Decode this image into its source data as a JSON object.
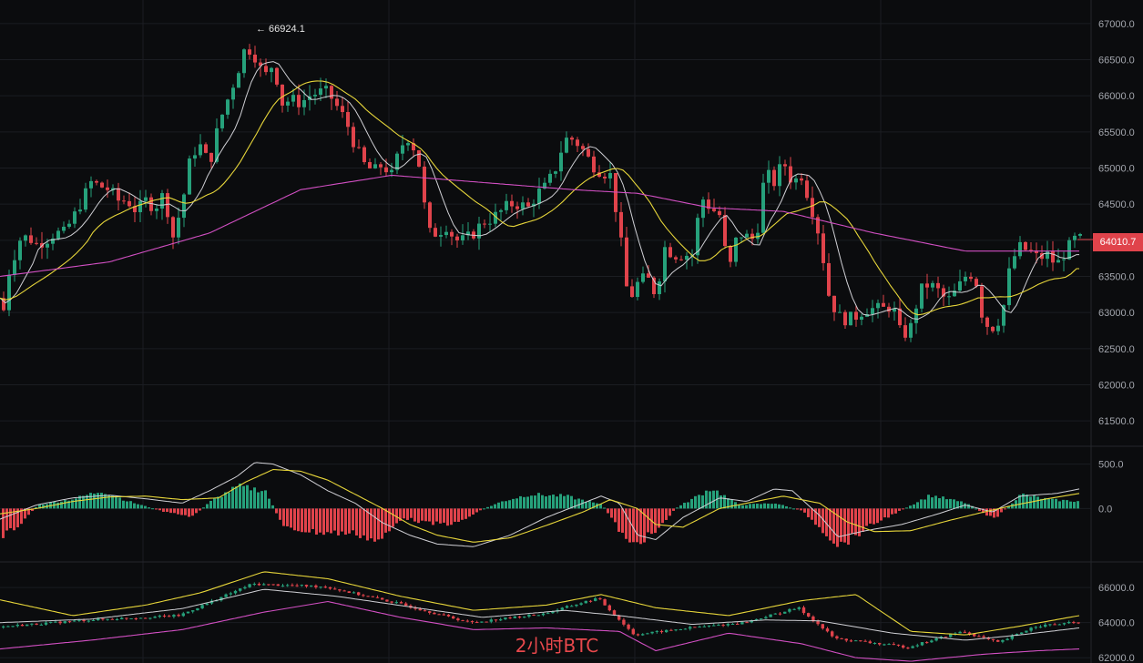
{
  "caption": "2小时BTC",
  "last_price": "64010.7",
  "peak_label": "← 66924.1",
  "colors": {
    "up": "#26a17b",
    "down": "#e0434b",
    "ma_fast": "#cfcfd4",
    "ma_mid": "#e6d53a",
    "ma_slow": "#d14fc2",
    "grid": "#1b1d22",
    "axis_text": "#a3a6ad"
  },
  "chart_data": [
    {
      "type": "candlestick",
      "title": "",
      "panel": "price",
      "ylim": [
        61300,
        67200
      ],
      "y_ticks": [
        "67000.0",
        "66500.0",
        "66000.0",
        "65500.0",
        "65000.0",
        "64500.0",
        "64000.0",
        "63500.0",
        "63000.0",
        "62500.0",
        "62000.0",
        "61500.0"
      ],
      "approx_path": [
        [
          0,
          63200
        ],
        [
          6,
          62800
        ],
        [
          12,
          63500
        ],
        [
          18,
          63700
        ],
        [
          24,
          64000
        ],
        [
          34,
          64050
        ],
        [
          44,
          63950
        ],
        [
          54,
          64000
        ],
        [
          64,
          64100
        ],
        [
          74,
          64100
        ],
        [
          84,
          64300
        ],
        [
          94,
          64550
        ],
        [
          104,
          64800
        ],
        [
          114,
          64750
        ],
        [
          124,
          64700
        ],
        [
          134,
          64550
        ],
        [
          144,
          64550
        ],
        [
          154,
          64400
        ],
        [
          164,
          64550
        ],
        [
          174,
          64450
        ],
        [
          184,
          64650
        ],
        [
          194,
          64050
        ],
        [
          204,
          64500
        ],
        [
          214,
          65200
        ],
        [
          224,
          65300
        ],
        [
          234,
          65050
        ],
        [
          244,
          65600
        ],
        [
          254,
          65950
        ],
        [
          264,
          66300
        ],
        [
          274,
          66700
        ],
        [
          284,
          66550
        ],
        [
          294,
          66250
        ],
        [
          304,
          66450
        ],
        [
          314,
          65900
        ],
        [
          324,
          65950
        ],
        [
          334,
          65900
        ],
        [
          344,
          66000
        ],
        [
          354,
          66050
        ],
        [
          364,
          66050
        ],
        [
          374,
          65850
        ],
        [
          384,
          65650
        ],
        [
          394,
          65300
        ],
        [
          404,
          65050
        ],
        [
          414,
          64950
        ],
        [
          424,
          65050
        ],
        [
          434,
          64900
        ],
        [
          444,
          65300
        ],
        [
          454,
          65450
        ],
        [
          464,
          65050
        ],
        [
          474,
          64100
        ],
        [
          484,
          64100
        ],
        [
          494,
          64200
        ],
        [
          504,
          64000
        ],
        [
          514,
          64000
        ],
        [
          524,
          64100
        ],
        [
          534,
          64250
        ],
        [
          544,
          64300
        ],
        [
          554,
          64400
        ],
        [
          564,
          64500
        ],
        [
          574,
          64500
        ],
        [
          584,
          64450
        ],
        [
          594,
          64650
        ],
        [
          604,
          64750
        ],
        [
          614,
          65000
        ],
        [
          624,
          65400
        ],
        [
          634,
          65400
        ],
        [
          644,
          65250
        ],
        [
          654,
          65050
        ],
        [
          664,
          64950
        ],
        [
          674,
          64900
        ],
        [
          684,
          64150
        ],
        [
          694,
          63150
        ],
        [
          704,
          63400
        ],
        [
          714,
          63500
        ],
        [
          724,
          63250
        ],
        [
          734,
          63900
        ],
        [
          744,
          63800
        ],
        [
          754,
          63800
        ],
        [
          764,
          63800
        ],
        [
          774,
          64600
        ],
        [
          784,
          64450
        ],
        [
          794,
          64350
        ],
        [
          804,
          63550
        ],
        [
          814,
          64100
        ],
        [
          824,
          64050
        ],
        [
          834,
          64000
        ],
        [
          844,
          64950
        ],
        [
          854,
          64800
        ],
        [
          864,
          65100
        ],
        [
          874,
          64800
        ],
        [
          884,
          64900
        ],
        [
          894,
          64500
        ],
        [
          904,
          64050
        ],
        [
          914,
          63250
        ],
        [
          924,
          62950
        ],
        [
          934,
          62900
        ],
        [
          944,
          62950
        ],
        [
          954,
          63050
        ],
        [
          964,
          63050
        ],
        [
          974,
          63050
        ],
        [
          984,
          63100
        ],
        [
          994,
          62650
        ],
        [
          1004,
          62800
        ],
        [
          1014,
          63300
        ],
        [
          1024,
          63400
        ],
        [
          1034,
          63300
        ],
        [
          1044,
          63150
        ],
        [
          1054,
          63300
        ],
        [
          1064,
          63500
        ],
        [
          1074,
          63550
        ],
        [
          1084,
          62850
        ],
        [
          1094,
          62800
        ],
        [
          1104,
          62950
        ],
        [
          1114,
          63700
        ],
        [
          1124,
          63900
        ],
        [
          1134,
          63850
        ],
        [
          1144,
          63750
        ],
        [
          1154,
          63800
        ],
        [
          1164,
          63650
        ],
        [
          1174,
          63850
        ],
        [
          1184,
          64010.7
        ]
      ],
      "ma_slow": [
        [
          0,
          63500
        ],
        [
          120,
          63700
        ],
        [
          230,
          64100
        ],
        [
          330,
          64700
        ],
        [
          430,
          64900
        ],
        [
          530,
          64800
        ],
        [
          630,
          64700
        ],
        [
          700,
          64650
        ],
        [
          780,
          64450
        ],
        [
          860,
          64400
        ],
        [
          960,
          64100
        ],
        [
          1060,
          63850
        ],
        [
          1180,
          63850
        ]
      ],
      "last_price": 64010.7,
      "peak": 66924.1
    },
    {
      "type": "macd",
      "panel": "macd",
      "ylim": [
        -550,
        650
      ],
      "y_ticks": [
        "500.0",
        "0.0"
      ],
      "macd_line": [
        [
          0,
          -120
        ],
        [
          40,
          40
        ],
        [
          80,
          120
        ],
        [
          120,
          150
        ],
        [
          160,
          110
        ],
        [
          200,
          60
        ],
        [
          230,
          200
        ],
        [
          260,
          360
        ],
        [
          280,
          520
        ],
        [
          300,
          500
        ],
        [
          330,
          380
        ],
        [
          360,
          200
        ],
        [
          390,
          60
        ],
        [
          420,
          -160
        ],
        [
          450,
          -300
        ],
        [
          480,
          -400
        ],
        [
          520,
          -430
        ],
        [
          560,
          -300
        ],
        [
          600,
          -100
        ],
        [
          640,
          60
        ],
        [
          660,
          140
        ],
        [
          680,
          60
        ],
        [
          700,
          -300
        ],
        [
          720,
          -350
        ],
        [
          750,
          -100
        ],
        [
          790,
          120
        ],
        [
          820,
          80
        ],
        [
          850,
          220
        ],
        [
          870,
          200
        ],
        [
          900,
          -80
        ],
        [
          920,
          -320
        ],
        [
          950,
          -250
        ],
        [
          990,
          -180
        ],
        [
          1030,
          -60
        ],
        [
          1060,
          40
        ],
        [
          1090,
          -40
        ],
        [
          1120,
          140
        ],
        [
          1160,
          170
        ],
        [
          1185,
          220
        ]
      ],
      "signal_line": [
        [
          0,
          -60
        ],
        [
          40,
          0
        ],
        [
          80,
          80
        ],
        [
          120,
          130
        ],
        [
          160,
          140
        ],
        [
          200,
          100
        ],
        [
          240,
          120
        ],
        [
          270,
          300
        ],
        [
          300,
          440
        ],
        [
          330,
          420
        ],
        [
          360,
          320
        ],
        [
          390,
          160
        ],
        [
          420,
          0
        ],
        [
          450,
          -180
        ],
        [
          480,
          -300
        ],
        [
          520,
          -380
        ],
        [
          560,
          -330
        ],
        [
          600,
          -190
        ],
        [
          640,
          -40
        ],
        [
          670,
          100
        ],
        [
          700,
          0
        ],
        [
          720,
          -180
        ],
        [
          750,
          -210
        ],
        [
          790,
          0
        ],
        [
          820,
          60
        ],
        [
          860,
          140
        ],
        [
          900,
          60
        ],
        [
          930,
          -150
        ],
        [
          960,
          -260
        ],
        [
          1000,
          -250
        ],
        [
          1040,
          -140
        ],
        [
          1080,
          -40
        ],
        [
          1110,
          30
        ],
        [
          1150,
          110
        ],
        [
          1185,
          170
        ]
      ],
      "histogram_trend": [
        [
          0,
          -320
        ],
        [
          20,
          -180
        ],
        [
          40,
          40
        ],
        [
          80,
          110
        ],
        [
          110,
          200
        ],
        [
          140,
          80
        ],
        [
          180,
          -40
        ],
        [
          210,
          -90
        ],
        [
          230,
          80
        ],
        [
          260,
          250
        ],
        [
          290,
          200
        ],
        [
          310,
          -220
        ],
        [
          350,
          -270
        ],
        [
          390,
          -280
        ],
        [
          415,
          -380
        ],
        [
          440,
          -100
        ],
        [
          470,
          -170
        ],
        [
          500,
          -170
        ],
        [
          530,
          0
        ],
        [
          550,
          80
        ],
        [
          580,
          160
        ],
        [
          620,
          140
        ],
        [
          660,
          40
        ],
        [
          690,
          -420
        ],
        [
          720,
          -260
        ],
        [
          740,
          0
        ],
        [
          780,
          230
        ],
        [
          810,
          40
        ],
        [
          850,
          60
        ],
        [
          880,
          -30
        ],
        [
          920,
          -420
        ],
        [
          960,
          -160
        ],
        [
          990,
          -10
        ],
        [
          1020,
          150
        ],
        [
          1060,
          60
        ],
        [
          1090,
          -120
        ],
        [
          1120,
          160
        ],
        [
          1150,
          100
        ],
        [
          1185,
          80
        ]
      ]
    },
    {
      "type": "candlestick",
      "panel": "lower",
      "ylim": [
        61700,
        67200
      ],
      "y_ticks": [
        "66000.0",
        "64000.0",
        "62000.0"
      ],
      "approx_path": [
        [
          0,
          63750
        ],
        [
          100,
          64150
        ],
        [
          200,
          64400
        ],
        [
          280,
          66200
        ],
        [
          360,
          66050
        ],
        [
          440,
          65100
        ],
        [
          520,
          64000
        ],
        [
          600,
          64500
        ],
        [
          660,
          65400
        ],
        [
          700,
          63300
        ],
        [
          760,
          63700
        ],
        [
          820,
          64000
        ],
        [
          880,
          64850
        ],
        [
          920,
          63100
        ],
        [
          1000,
          62600
        ],
        [
          1060,
          63500
        ],
        [
          1100,
          62850
        ],
        [
          1140,
          63800
        ],
        [
          1185,
          64010
        ]
      ],
      "upper_band": [
        [
          0,
          65300
        ],
        [
          80,
          64400
        ],
        [
          160,
          65000
        ],
        [
          220,
          65700
        ],
        [
          290,
          66900
        ],
        [
          360,
          66500
        ],
        [
          440,
          65500
        ],
        [
          520,
          64700
        ],
        [
          600,
          65000
        ],
        [
          660,
          65600
        ],
        [
          720,
          64850
        ],
        [
          800,
          64400
        ],
        [
          880,
          65250
        ],
        [
          940,
          65600
        ],
        [
          1000,
          63500
        ],
        [
          1060,
          63300
        ],
        [
          1120,
          63800
        ],
        [
          1185,
          64400
        ]
      ],
      "middle_band": [
        [
          0,
          64000
        ],
        [
          100,
          64200
        ],
        [
          200,
          64800
        ],
        [
          290,
          65900
        ],
        [
          370,
          65500
        ],
        [
          450,
          64900
        ],
        [
          530,
          64300
        ],
        [
          620,
          64700
        ],
        [
          680,
          64400
        ],
        [
          760,
          63900
        ],
        [
          840,
          64150
        ],
        [
          900,
          64100
        ],
        [
          980,
          63400
        ],
        [
          1060,
          63000
        ],
        [
          1120,
          63300
        ],
        [
          1185,
          63700
        ]
      ],
      "lower_band": [
        [
          0,
          62500
        ],
        [
          100,
          63000
        ],
        [
          200,
          63600
        ],
        [
          290,
          64600
        ],
        [
          360,
          65200
        ],
        [
          440,
          64300
        ],
        [
          520,
          63600
        ],
        [
          600,
          63700
        ],
        [
          680,
          63500
        ],
        [
          720,
          62400
        ],
        [
          800,
          63400
        ],
        [
          880,
          62800
        ],
        [
          940,
          62000
        ],
        [
          1000,
          61800
        ],
        [
          1080,
          62200
        ],
        [
          1140,
          62400
        ],
        [
          1185,
          62500
        ]
      ]
    }
  ]
}
